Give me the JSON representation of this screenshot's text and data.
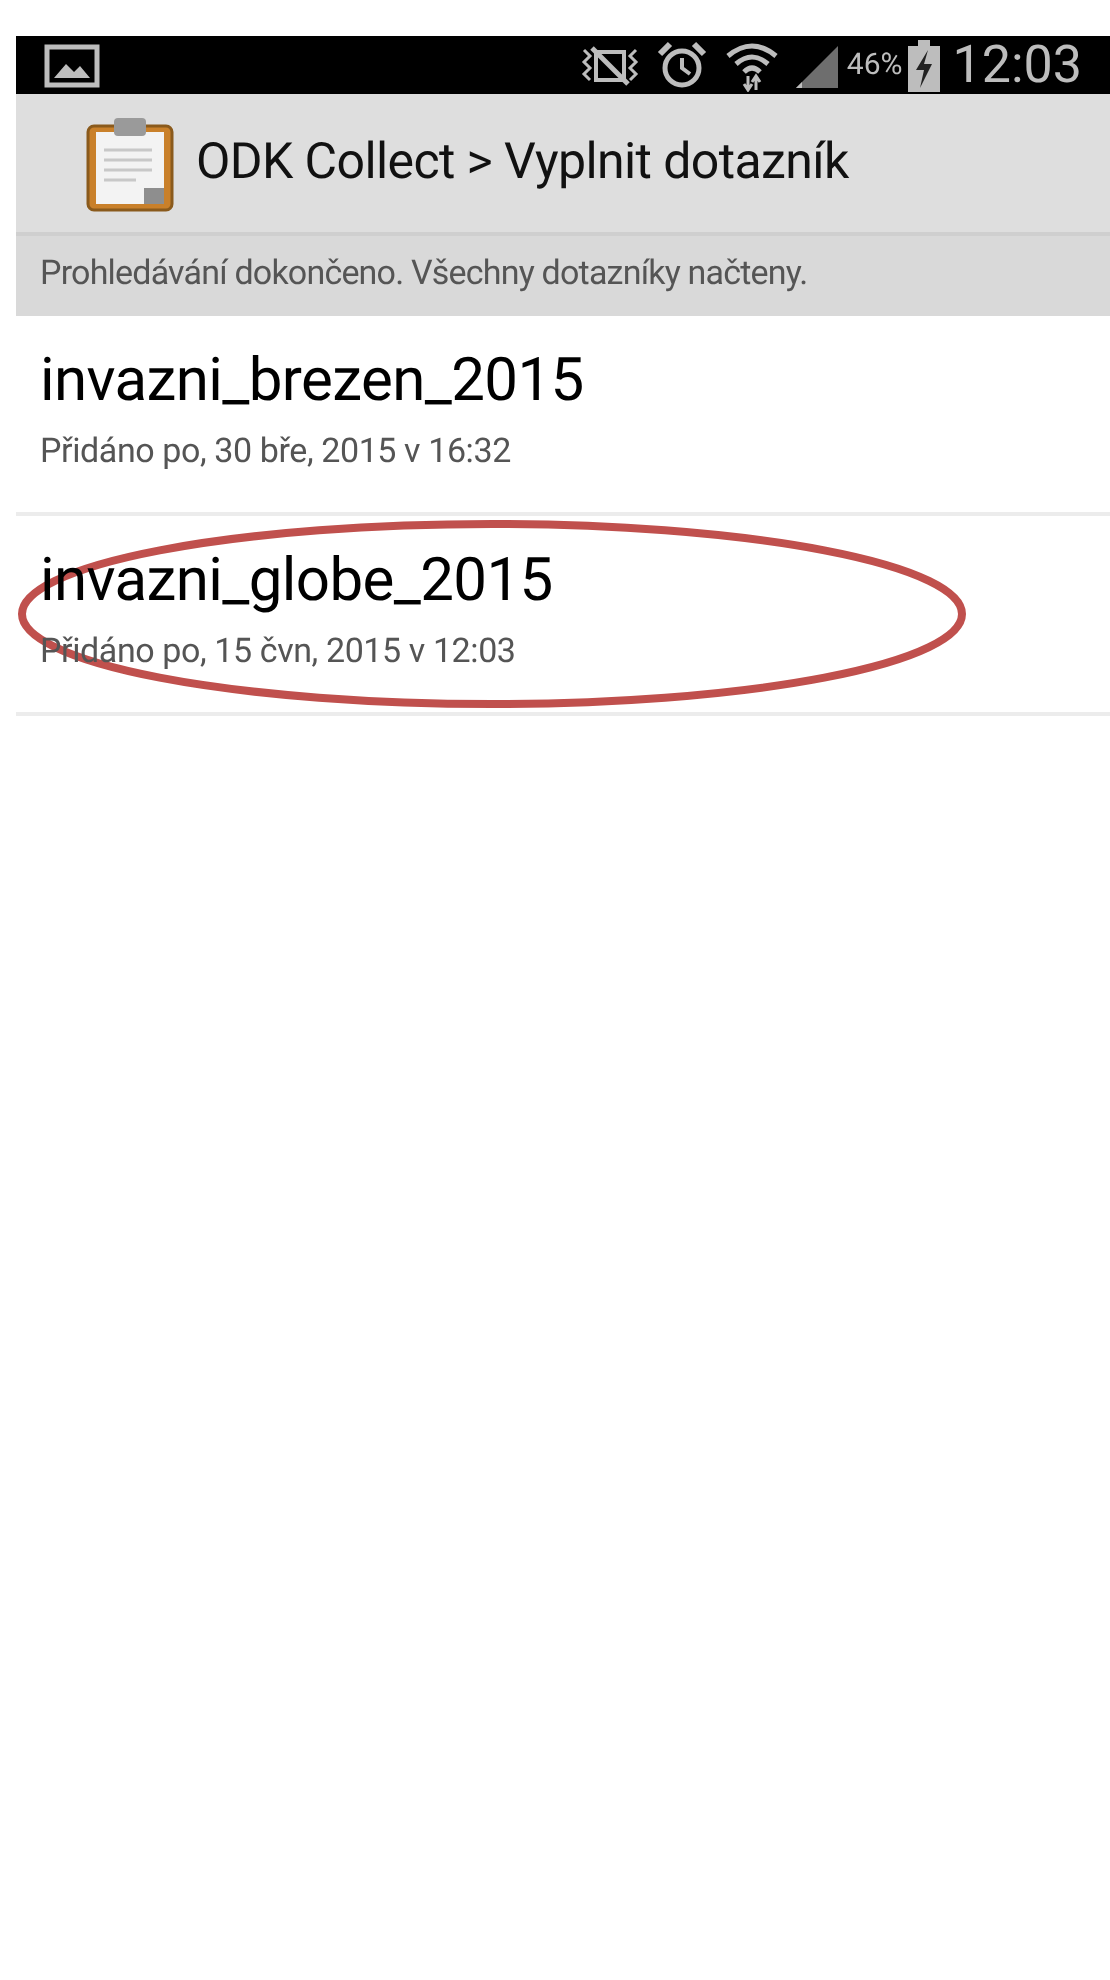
{
  "status_bar": {
    "battery": "46%",
    "time": "12:03"
  },
  "action_bar": {
    "title": "ODK Collect > Vyplnit dotazník"
  },
  "message": "Prohledávání dokončeno. Všechny dotazníky načteny.",
  "forms": [
    {
      "name": "invazni_brezen_2015",
      "added": "Přidáno po, 30 bře, 2015 v 16:32",
      "circled": false
    },
    {
      "name": "invazni_globe_2015",
      "added": "Přidáno po, 15 čvn, 2015 v 12:03",
      "circled": true
    }
  ]
}
